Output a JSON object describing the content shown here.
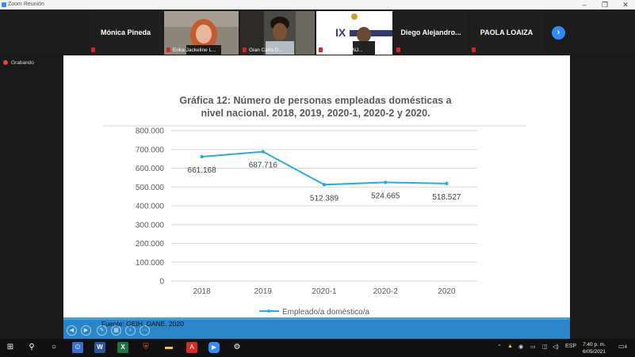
{
  "window": {
    "title": "Zoom Reunión"
  },
  "participants": [
    {
      "name": "Mónica Pineda",
      "type": "name"
    },
    {
      "name": "Erika Jackeline L...",
      "type": "video"
    },
    {
      "name": "Gian Carlo D...",
      "type": "video"
    },
    {
      "name": "EFRAIN TUNJ...",
      "type": "video",
      "banner": "IX"
    },
    {
      "name": "Diego  Alejandro...",
      "type": "name"
    },
    {
      "name": "PAOLA LOAIZA",
      "type": "name"
    }
  ],
  "recording": {
    "label": "Grabando"
  },
  "slide": {
    "source": "Fuente: GEIH, DANE. 2020"
  },
  "chart_data": {
    "type": "line",
    "title_line1": "Gráfica 12: Número de personas empleadas domésticas a",
    "title_line2": "nivel nacional. 2018, 2019, 2020-1, 2020-2 y 2020.",
    "categories": [
      "2018",
      "2019",
      "2020-1",
      "2020-2",
      "2020"
    ],
    "series": [
      {
        "name": "Empleado/a doméstico/a",
        "values": [
          661168,
          687716,
          512389,
          524665,
          518527
        ],
        "labels": [
          "661.168",
          "687.716",
          "512.389",
          "524.665",
          "518.527"
        ],
        "color": "#29abe2"
      }
    ],
    "y_ticks": [
      "0",
      "100.000",
      "200.000",
      "300.000",
      "400.000",
      "500.000",
      "600.000",
      "700.000",
      "800.000"
    ],
    "ylim": [
      0,
      800000
    ],
    "grid": true,
    "legend": "bottom"
  },
  "taskbar": {
    "language": "ESP",
    "time": "7:40 p. m.",
    "date": "6/05/2021",
    "notifications": "4"
  }
}
